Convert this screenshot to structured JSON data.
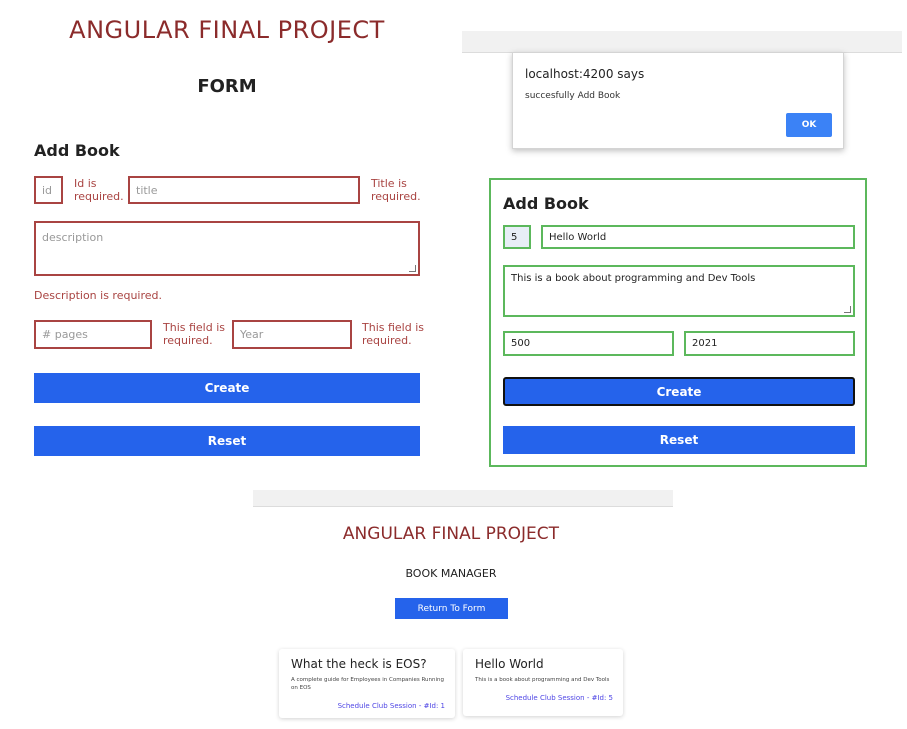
{
  "left": {
    "app_title": "ANGULAR FINAL PROJECT",
    "form_heading": "FORM",
    "section_title": "Add Book",
    "placeholders": {
      "id": "id",
      "title": "title",
      "description": "description",
      "pages": "# pages",
      "year": "Year"
    },
    "errors": {
      "id_line1": "Id is",
      "id_line2": "required.",
      "title_line1": "Title is",
      "title_line2": "required.",
      "description": "Description is required.",
      "pages_line1": "This field is",
      "pages_line2": "required.",
      "year_line1": "This field is",
      "year_line2": "required."
    },
    "create_label": "Create",
    "reset_label": "Reset"
  },
  "alert": {
    "title": "localhost:4200 says",
    "message": "succesfully Add Book",
    "ok_label": "OK"
  },
  "valid_form": {
    "section_title": "Add Book",
    "values": {
      "id": "5",
      "title": "Hello World",
      "description": "This is a book about programming and Dev Tools",
      "pages": "500",
      "year": "2021"
    },
    "create_label": "Create",
    "reset_label": "Reset"
  },
  "manager": {
    "app_title": "ANGULAR FINAL PROJECT",
    "subtitle": "BOOK MANAGER",
    "return_label": "Return To Form",
    "books": [
      {
        "title": "What the heck is EOS?",
        "description": "A complete guide for Employees in Companies Running on EOS",
        "link": "Schedule Club Session - #Id: 1"
      },
      {
        "title": "Hello World",
        "description": "This is a book about programming and Dev Tools",
        "link": "Schedule Club Session - #Id: 5"
      }
    ]
  },
  "colors": {
    "title_red": "#8b2b2b",
    "error_red": "#a94442",
    "valid_green": "#5cb85c",
    "primary_blue": "#2563eb"
  }
}
